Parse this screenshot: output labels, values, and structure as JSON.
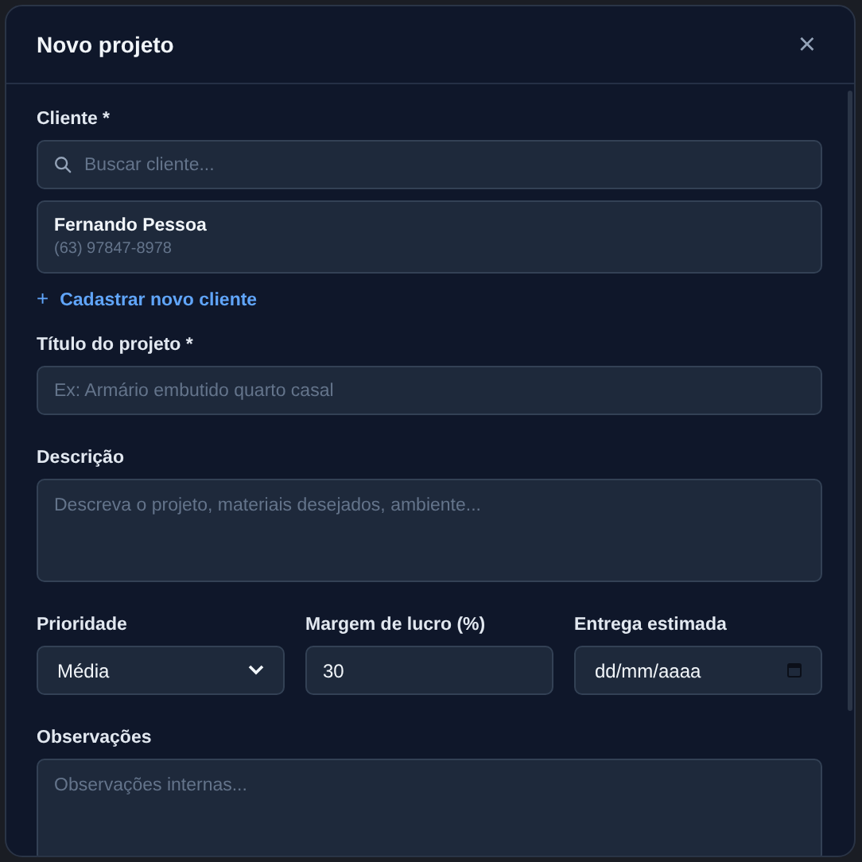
{
  "dialog": {
    "title": "Novo projeto",
    "close": "×"
  },
  "client": {
    "label": "Cliente *",
    "search": {
      "placeholder": "Buscar cliente..."
    },
    "selected_client": {
      "name": "Fernando Pessoa",
      "phone": "(63) 97847-8978"
    },
    "add_link": {
      "icon": "+",
      "label": "Cadastrar novo cliente"
    }
  },
  "title_field": {
    "label": "Título do projeto *",
    "placeholder": "Ex: Armário embutido quarto casal"
  },
  "description": {
    "label": "Descrição",
    "placeholder": "Descreva o projeto, materiais desejados, ambiente..."
  },
  "row": [
    {
      "kind": "select",
      "label": "Prioridade",
      "value": "Média"
    },
    {
      "kind": "number",
      "label": "Margem de lucro (%)",
      "value": "30"
    },
    {
      "kind": "date",
      "label": "Entrega estimada",
      "value": "dd/mm/aaaa"
    }
  ],
  "notes": {
    "label": "Observações",
    "placeholder": "Observações internas..."
  }
}
